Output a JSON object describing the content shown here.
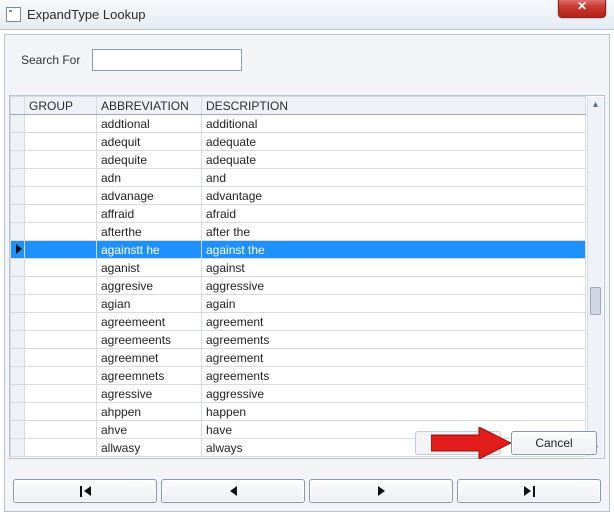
{
  "window": {
    "title": "ExpandType Lookup"
  },
  "search": {
    "label": "Search For",
    "value": ""
  },
  "columns": {
    "selector": "",
    "group": "GROUP",
    "abbr": "ABBREVIATION",
    "desc": "DESCRIPTION"
  },
  "selected_index": 7,
  "rows": [
    {
      "group": "",
      "abbr": "addtional",
      "desc": "additional"
    },
    {
      "group": "",
      "abbr": "adequit",
      "desc": "adequate"
    },
    {
      "group": "",
      "abbr": "adequite",
      "desc": "adequate"
    },
    {
      "group": "",
      "abbr": "adn",
      "desc": "and"
    },
    {
      "group": "",
      "abbr": "advanage",
      "desc": "advantage"
    },
    {
      "group": "",
      "abbr": "affraid",
      "desc": "afraid"
    },
    {
      "group": "",
      "abbr": "afterthe",
      "desc": "after the"
    },
    {
      "group": "",
      "abbr": "againstt he",
      "desc": "against the"
    },
    {
      "group": "",
      "abbr": "aganist",
      "desc": "against"
    },
    {
      "group": "",
      "abbr": "aggresive",
      "desc": "aggressive"
    },
    {
      "group": "",
      "abbr": "agian",
      "desc": "again"
    },
    {
      "group": "",
      "abbr": "agreemeent",
      "desc": "agreement"
    },
    {
      "group": "",
      "abbr": "agreemeents",
      "desc": "agreements"
    },
    {
      "group": "",
      "abbr": "agreemnet",
      "desc": "agreement"
    },
    {
      "group": "",
      "abbr": "agreemnets",
      "desc": "agreements"
    },
    {
      "group": "",
      "abbr": "agressive",
      "desc": "aggressive"
    },
    {
      "group": "",
      "abbr": "ahppen",
      "desc": "happen"
    },
    {
      "group": "",
      "abbr": "ahve",
      "desc": "have"
    },
    {
      "group": "",
      "abbr": "allwasy",
      "desc": "always"
    }
  ],
  "buttons": {
    "cancel": "Cancel"
  },
  "nav": {
    "first": "first",
    "prev": "prev",
    "next": "next",
    "last": "last"
  }
}
